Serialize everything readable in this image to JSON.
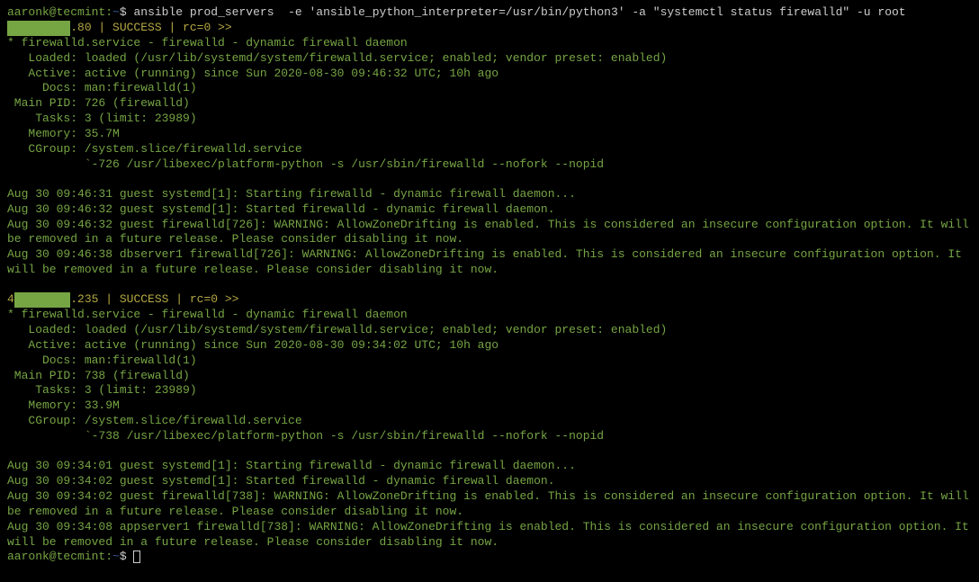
{
  "prompt": {
    "user_host": "aaronk@tecmint",
    "sep": ":",
    "path": "~",
    "dollar": "$"
  },
  "command": "ansible prod_servers  -e 'ansible_python_interpreter=/usr/bin/python3' -a \"systemctl status firewalld\" -u root",
  "host1": {
    "ip_tail": ".80",
    "status_line": " | SUCCESS | rc=0 >>",
    "bullet": "*",
    "service_title": " firewalld.service - firewalld - dynamic firewall daemon",
    "loaded": "   Loaded: loaded (/usr/lib/systemd/system/firewalld.service; enabled; vendor preset: enabled)",
    "active": "   Active: active (running) since Sun 2020-08-30 09:46:32 UTC; 10h ago",
    "docs": "     Docs: man:firewalld(1)",
    "mainpid": " Main PID: 726 (firewalld)",
    "tasks": "    Tasks: 3 (limit: 23989)",
    "memory": "   Memory: 35.7M",
    "cgroup1": "   CGroup: /system.slice/firewalld.service",
    "cgroup2": "           `-726 /usr/libexec/platform-python -s /usr/sbin/firewalld --nofork --nopid",
    "log1": "Aug 30 09:46:31 guest systemd[1]: Starting firewalld - dynamic firewall daemon...",
    "log2": "Aug 30 09:46:32 guest systemd[1]: Started firewalld - dynamic firewall daemon.",
    "log3": "Aug 30 09:46:32 guest firewalld[726]: WARNING: AllowZoneDrifting is enabled. This is considered an insecure configuration option. It will be removed in a future release. Please consider disabling it now.",
    "log4": "Aug 30 09:46:38 dbserver1 firewalld[726]: WARNING: AllowZoneDrifting is enabled. This is considered an insecure configuration option. It will be removed in a future release. Please consider disabling it now."
  },
  "host2": {
    "ip_prefix": "4",
    "ip_tail": ".235",
    "status_line": " | SUCCESS | rc=0 >>",
    "bullet": "*",
    "service_title": " firewalld.service - firewalld - dynamic firewall daemon",
    "loaded": "   Loaded: loaded (/usr/lib/systemd/system/firewalld.service; enabled; vendor preset: enabled)",
    "active": "   Active: active (running) since Sun 2020-08-30 09:34:02 UTC; 10h ago",
    "docs": "     Docs: man:firewalld(1)",
    "mainpid": " Main PID: 738 (firewalld)",
    "tasks": "    Tasks: 3 (limit: 23989)",
    "memory": "   Memory: 33.9M",
    "cgroup1": "   CGroup: /system.slice/firewalld.service",
    "cgroup2": "           `-738 /usr/libexec/platform-python -s /usr/sbin/firewalld --nofork --nopid",
    "log1": "Aug 30 09:34:01 guest systemd[1]: Starting firewalld - dynamic firewall daemon...",
    "log2": "Aug 30 09:34:02 guest systemd[1]: Started firewalld - dynamic firewall daemon.",
    "log3": "Aug 30 09:34:02 guest firewalld[738]: WARNING: AllowZoneDrifting is enabled. This is considered an insecure configuration option. It will be removed in a future release. Please consider disabling it now.",
    "log4": "Aug 30 09:34:08 appserver1 firewalld[738]: WARNING: AllowZoneDrifting is enabled. This is considered an insecure configuration option. It will be removed in a future release. Please consider disabling it now."
  }
}
